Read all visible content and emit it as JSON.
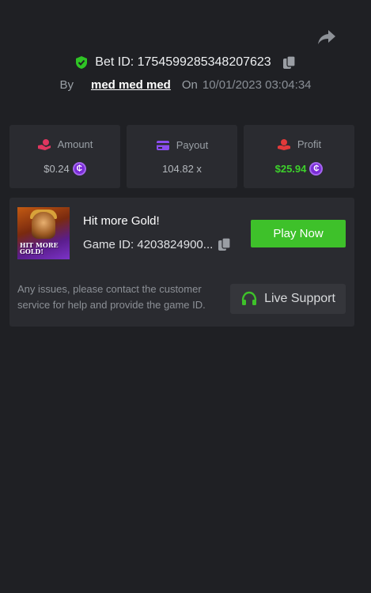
{
  "header": {
    "bet_id_label": "Bet ID: 1754599285348207623",
    "by_label": "By",
    "username": "med med med",
    "on_label": "On",
    "datetime": "10/01/2023 03:04:34"
  },
  "stats": {
    "amount": {
      "label": "Amount",
      "value": "$0.24"
    },
    "payout": {
      "label": "Payout",
      "value": "104.82 x"
    },
    "profit": {
      "label": "Profit",
      "value": "$25.94"
    }
  },
  "coin_symbol": "₵",
  "game": {
    "thumbnail_text": "HIT MORE GOLD!",
    "title": "Hit more Gold!",
    "game_id_label": "Game ID: 4203824900...",
    "play_label": "Play Now",
    "help_text": "Any issues, please contact the customer service for help and provide the game ID.",
    "support_label": "Live Support"
  },
  "colors": {
    "background": "#1f2024",
    "card": "#2a2b30",
    "accent_green": "#3ec12a",
    "profit_green": "#3dd12b",
    "coin_purple": "#7a2cd6",
    "amount_icon": "#e0365f",
    "payout_icon": "#8b4df0",
    "profit_icon": "#e23a3a"
  },
  "icons": {
    "share": "share-icon",
    "verified": "shield-check-icon",
    "copy": "copy-icon",
    "amount": "hand-coin-icon",
    "payout": "card-icon",
    "profit": "hand-money-icon",
    "support": "headset-icon"
  }
}
